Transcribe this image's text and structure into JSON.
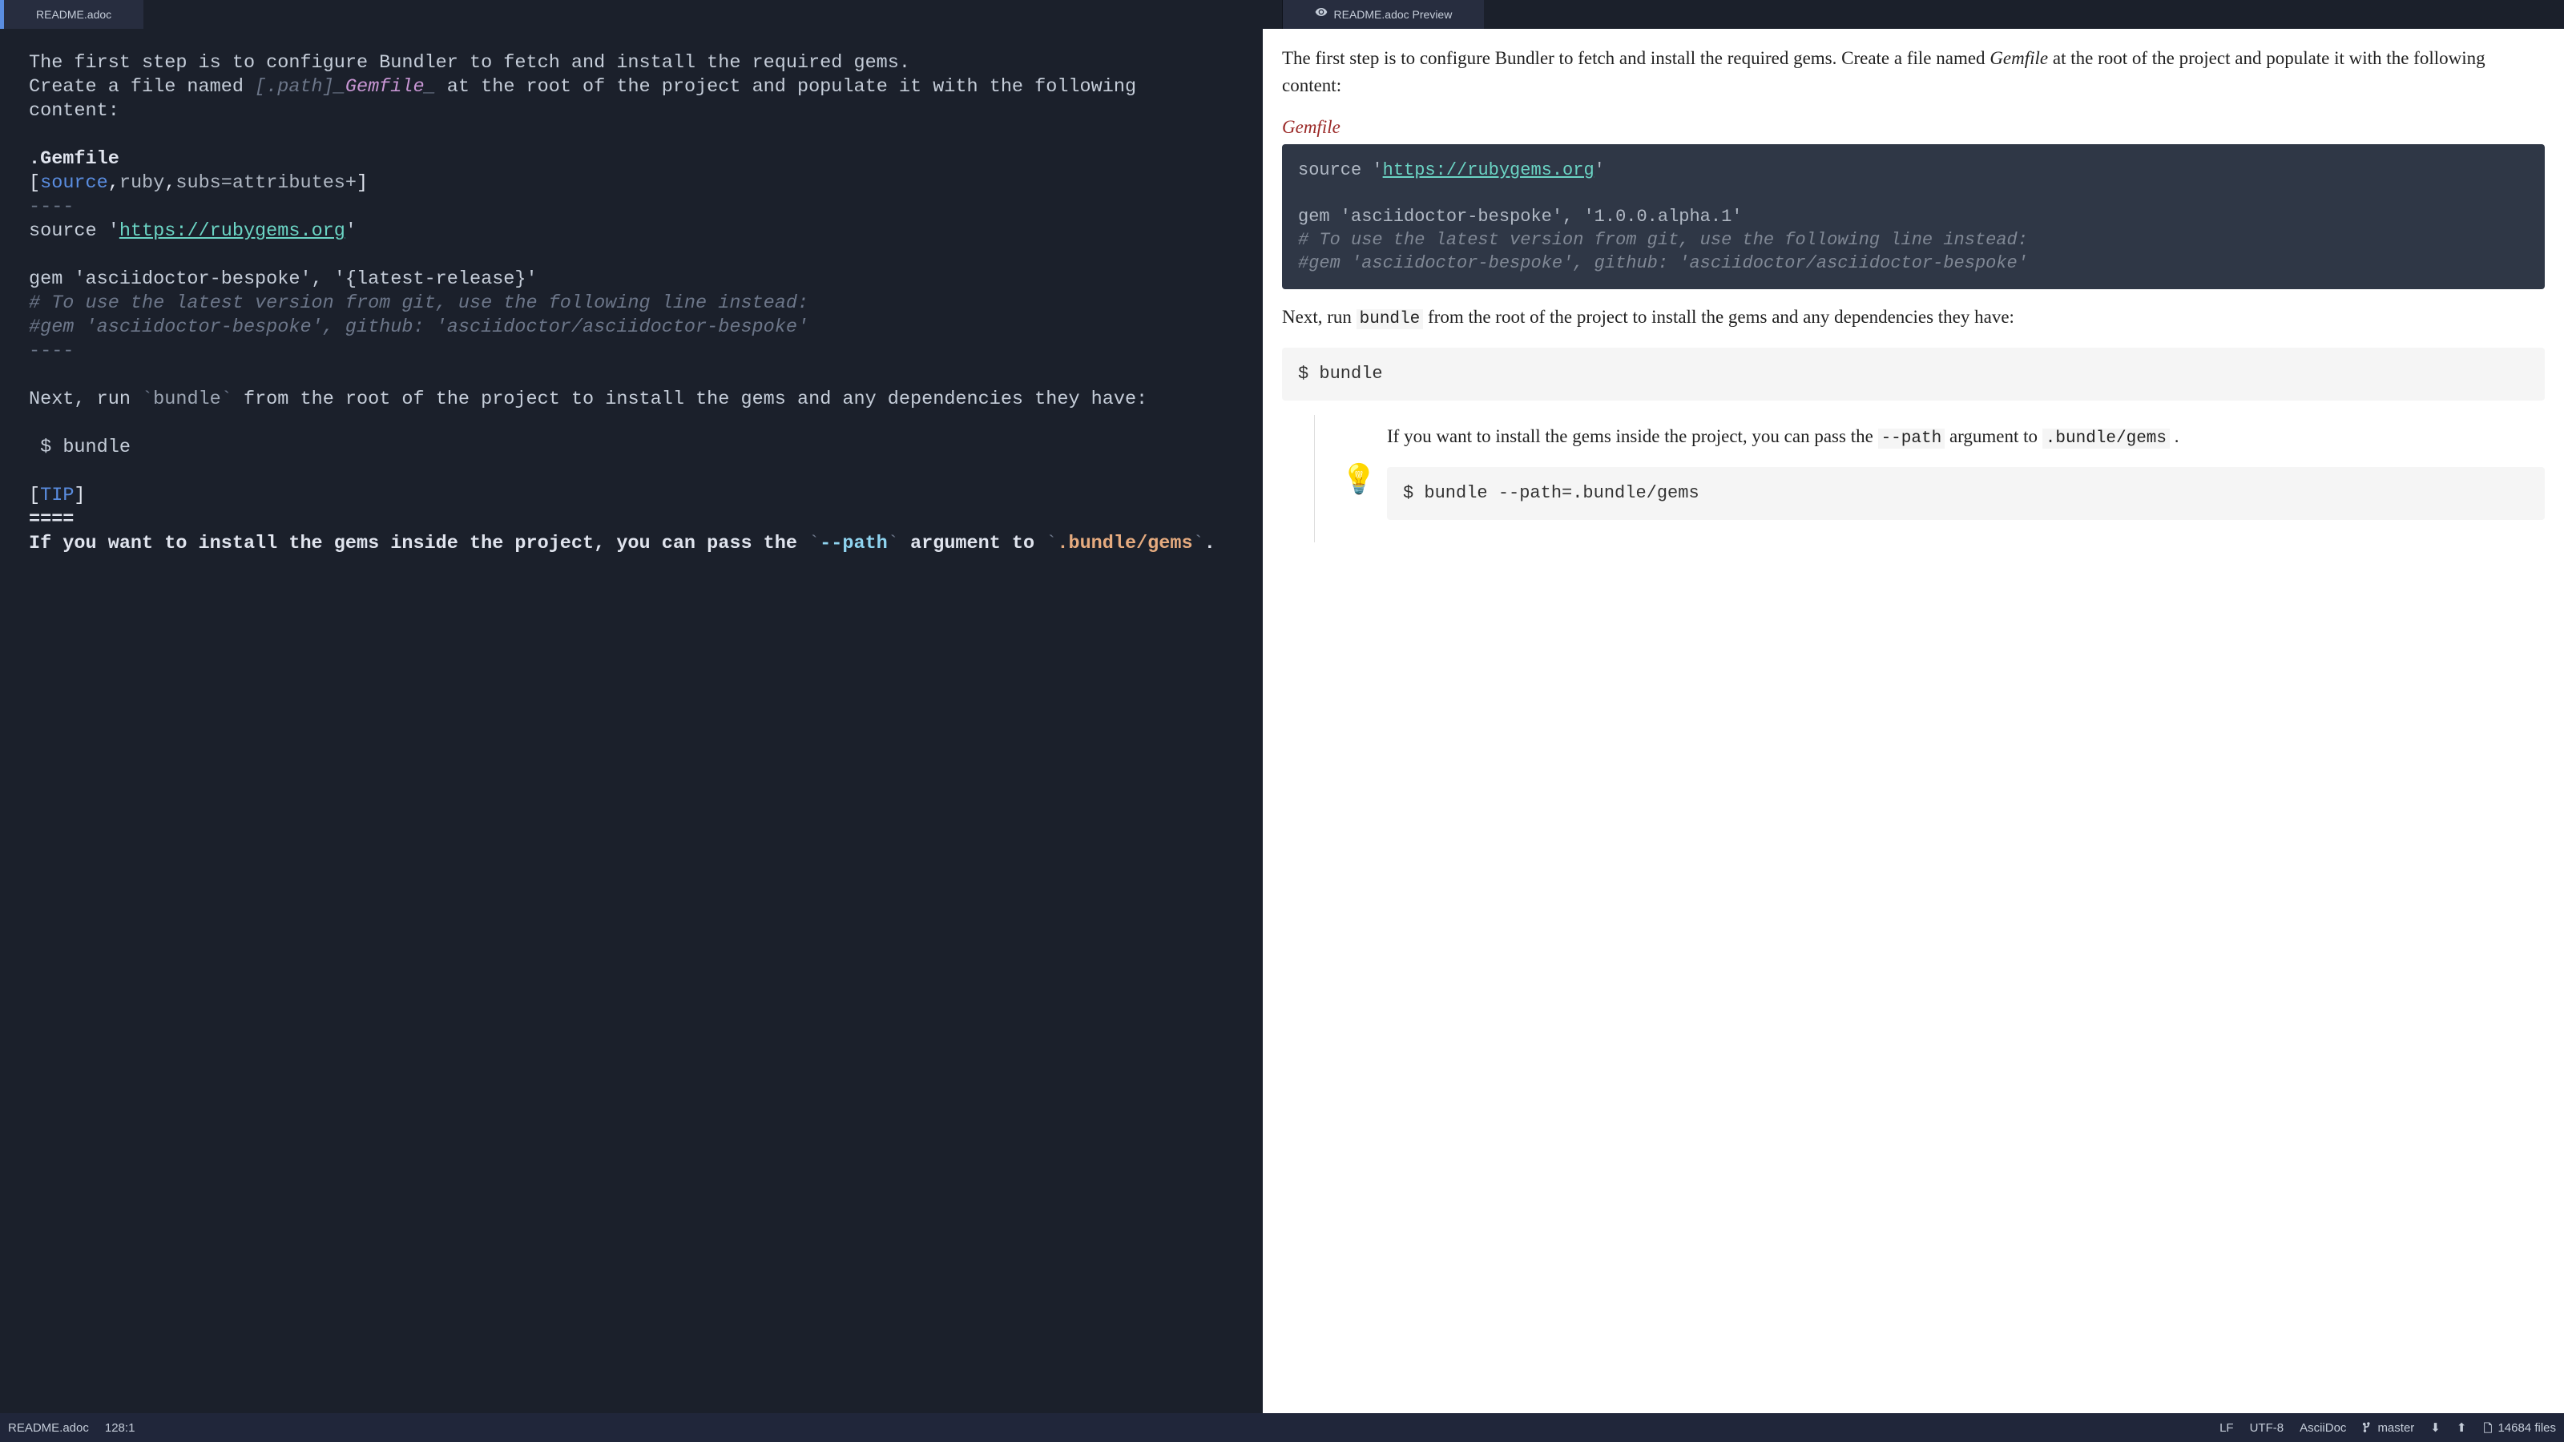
{
  "tabs": {
    "left": {
      "label": "README.adoc"
    },
    "right": {
      "label": "README.adoc Preview"
    }
  },
  "editor": {
    "para1a": "The first step is to configure Bundler to fetch and install the required gems.",
    "para1b_pre": "Create a file named ",
    "para1b_attr": "[.path]",
    "para1b_u1": "_",
    "para1b_val": "Gemfile",
    "para1b_u2": "_",
    "para1b_post": " at the root of the project and populate it with the following content:",
    "src_title": ".Gemfile",
    "br_open": "[",
    "kw_source": "source",
    "kw_comma1": ",",
    "kw_ruby": "ruby",
    "kw_comma2": ",",
    "kw_subs": "subs=attributes+",
    "br_close": "]",
    "dashes": "----",
    "ruby_src_pre": "source '",
    "ruby_src_url": "https://rubygems.org",
    "ruby_src_post": "'",
    "gem_line": "gem 'asciidoctor-bespoke', '{latest-release}'",
    "comment1": "# To use the latest version from git, use the following line instead:",
    "comment2": "#gem 'asciidoctor-bespoke', github: 'asciidoctor/asciidoctor-bespoke'",
    "para2_pre": "Next, run ",
    "para2_tick1": "`",
    "para2_code": "bundle",
    "para2_tick2": "`",
    "para2_post": " from the root of the project to install the gems and any dependencies they have:",
    "bundle_cmd": " $ bundle",
    "tip_open": "[",
    "tip_kw": "TIP",
    "tip_close": "]",
    "tip_eq": "====",
    "tip_text_pre": "If you want to install the gems inside the project, you can pass the ",
    "tip_tick1": "`",
    "tip_flag": "--path",
    "tip_tick2": "`",
    "tip_text_mid": " argument to ",
    "tip_tick3": "`",
    "tip_path": ".bundle/gems",
    "tip_tick4": "`",
    "tip_text_end": "."
  },
  "preview": {
    "para1_pre": "The first step is to configure Bundler to fetch and install the required gems. Create a file named ",
    "para1_em": "Gemfile",
    "para1_post": " at the root of the project and populate it with the following content:",
    "listing_title": "Gemfile",
    "code_src_pre": "source '",
    "code_src_url": "https://rubygems.org",
    "code_src_post": "'",
    "code_gem": "gem 'asciidoctor-bespoke', '1.0.0.alpha.1'",
    "code_c1": "# To use the latest version from git, use the following line instead:",
    "code_c2": "#gem 'asciidoctor-bespoke', github: 'asciidoctor/asciidoctor-bespoke'",
    "para2_pre": "Next, run ",
    "para2_code": "bundle",
    "para2_post": " from the root of the project to install the gems and any dependencies they have:",
    "bundle_cmd": "$ bundle",
    "tip_pre": "If you want to install the gems inside the project, you can pass the ",
    "tip_code1": "--path",
    "tip_mid": " argument to ",
    "tip_code2": ".bundle/gems",
    "tip_end": " .",
    "tip_cmd": "$ bundle --path=.bundle/gems"
  },
  "status": {
    "filename": "README.adoc",
    "cursor": "128:1",
    "eol": "LF",
    "encoding": "UTF-8",
    "grammar": "AsciiDoc",
    "branch": "master",
    "files": "14684 files"
  }
}
